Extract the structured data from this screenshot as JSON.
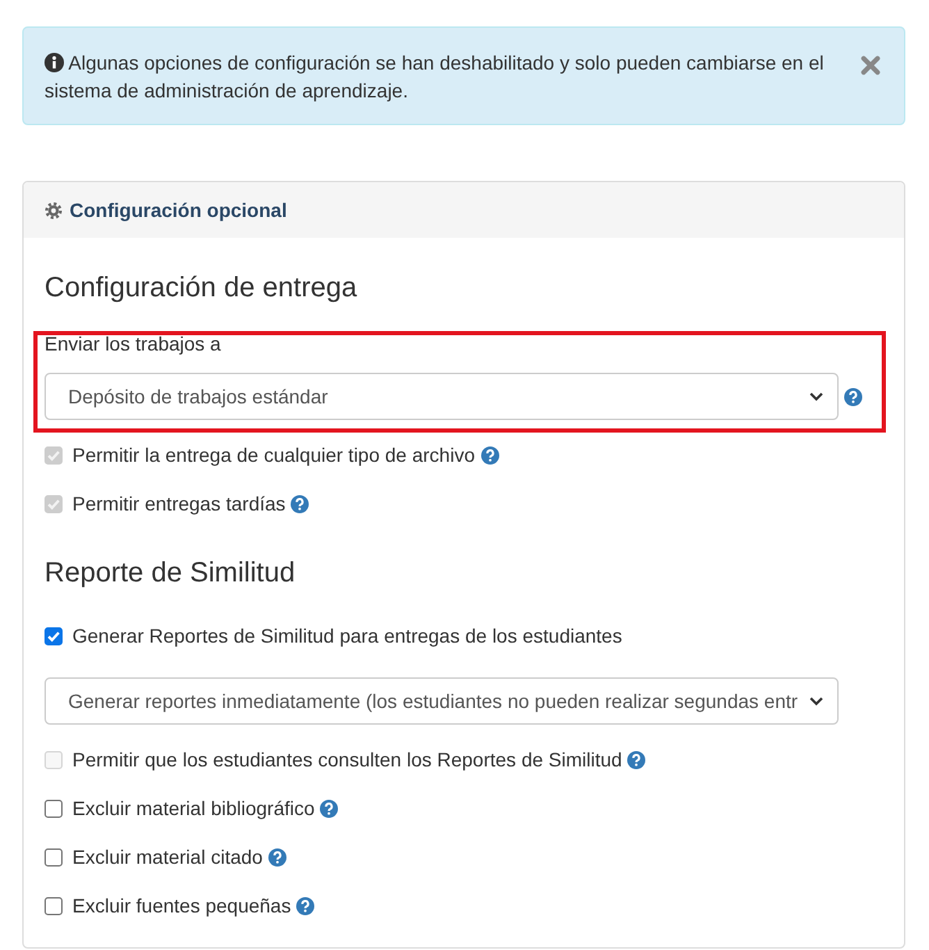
{
  "alert": {
    "message": "Algunas opciones de configuración se han deshabilitado y solo pueden cambiarse en el sistema de administración de aprendizaje.",
    "dismissible": true
  },
  "panel": {
    "title": "Configuración opcional",
    "sections": [
      {
        "heading": "Configuración de entrega",
        "items": [
          {
            "kind": "select",
            "label": "Enviar los trabajos a",
            "value": "Depósito de trabajos estándar",
            "help": true,
            "highlighted": true
          },
          {
            "kind": "checkbox",
            "label": "Permitir la entrega de cualquier tipo de archivo",
            "checked": true,
            "disabled": true,
            "help": true
          },
          {
            "kind": "checkbox",
            "label": "Permitir entregas tardías",
            "checked": true,
            "disabled": true,
            "help": true
          }
        ]
      },
      {
        "heading": "Reporte de Similitud",
        "items": [
          {
            "kind": "checkbox",
            "label": "Generar Reportes de Similitud para entregas de los estudiantes",
            "checked": true,
            "disabled": false,
            "help": false
          },
          {
            "kind": "select",
            "value": "Generar reportes inmediatamente (los estudiantes no pueden realizar segundas entr",
            "help": false,
            "highlighted": false
          },
          {
            "kind": "checkbox",
            "label": "Permitir que los estudiantes consulten los Reportes de Similitud",
            "checked": false,
            "disabled": true,
            "help": true
          },
          {
            "kind": "checkbox",
            "label": "Excluir material bibliográfico",
            "checked": false,
            "disabled": false,
            "help": true
          },
          {
            "kind": "checkbox",
            "label": "Excluir material citado",
            "checked": false,
            "disabled": false,
            "help": true
          },
          {
            "kind": "checkbox",
            "label": "Excluir fuentes pequeñas",
            "checked": false,
            "disabled": false,
            "help": true
          }
        ]
      }
    ]
  }
}
